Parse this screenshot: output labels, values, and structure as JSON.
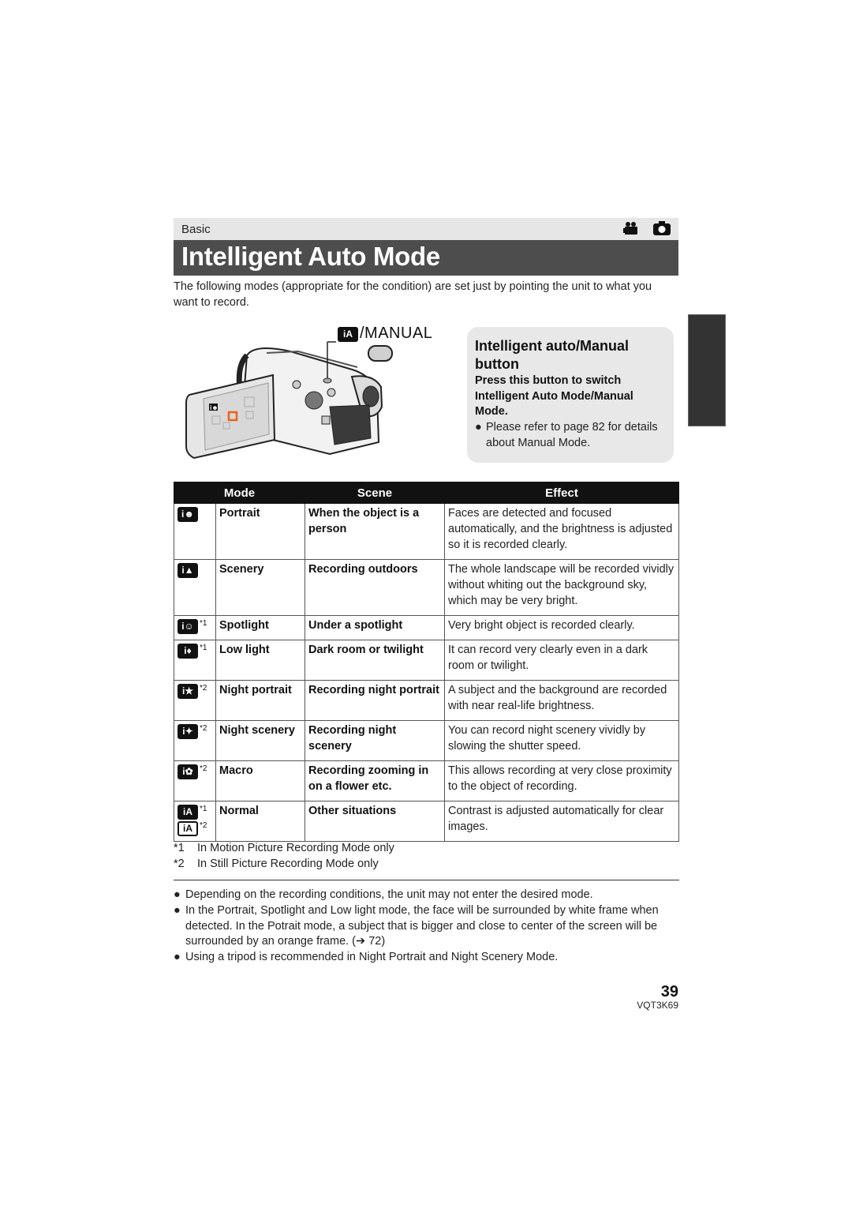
{
  "header": {
    "section": "Basic",
    "mode_icons": [
      "motion-picture-icon",
      "still-picture-icon"
    ],
    "title": "Intelligent Auto Mode"
  },
  "intro": "The following modes (appropriate for the condition) are set just by pointing the unit to what you want to record.",
  "illustration": {
    "button_label_icon": "iA",
    "button_label": "/MANUAL",
    "screen_icon": "i-portrait"
  },
  "callout": {
    "title": "Intelligent auto/Manual button",
    "instruction": "Press this button to switch Intelligent Auto Mode/Manual Mode.",
    "note": "Please refer to page 82 for details about Manual Mode."
  },
  "table": {
    "headers": [
      "Mode",
      "Scene",
      "Effect"
    ],
    "rows": [
      {
        "icons": [
          {
            "glyph": "i☻",
            "footnote": ""
          }
        ],
        "mode": "Portrait",
        "scene": "When the object is a person",
        "effect": "Faces are detected and focused automatically, and the brightness is adjusted so it is recorded clearly."
      },
      {
        "icons": [
          {
            "glyph": "i▲",
            "footnote": ""
          }
        ],
        "mode": "Scenery",
        "scene": "Recording outdoors",
        "effect": "The whole landscape will be recorded vividly without whiting out the background sky, which may be very bright."
      },
      {
        "icons": [
          {
            "glyph": "i☺",
            "footnote": "*1"
          }
        ],
        "mode": "Spotlight",
        "scene": "Under a spotlight",
        "effect": "Very bright object is recorded clearly."
      },
      {
        "icons": [
          {
            "glyph": "i♦",
            "footnote": "*1"
          }
        ],
        "mode": "Low light",
        "scene": "Dark room or twilight",
        "effect": "It can record very clearly even in a dark room or twilight."
      },
      {
        "icons": [
          {
            "glyph": "i★",
            "footnote": "*2"
          }
        ],
        "mode": "Night portrait",
        "scene": "Recording night portrait",
        "effect": "A subject and the background are recorded with near real-life brightness."
      },
      {
        "icons": [
          {
            "glyph": "i✦",
            "footnote": "*2"
          }
        ],
        "mode": "Night scenery",
        "scene": "Recording night scenery",
        "effect": "You can record night scenery vividly by slowing the shutter speed."
      },
      {
        "icons": [
          {
            "glyph": "i✿",
            "footnote": "*2"
          }
        ],
        "mode": "Macro",
        "scene": "Recording zooming in on a flower etc.",
        "effect": "This allows recording at very close proximity to the object of recording."
      },
      {
        "icons": [
          {
            "glyph": "iA",
            "footnote": "*1"
          },
          {
            "glyph": "iA",
            "footnote": "*2"
          }
        ],
        "mode": "Normal",
        "scene": "Other situations",
        "effect": "Contrast is adjusted automatically for clear images."
      }
    ]
  },
  "footnotes": [
    {
      "mark": "*1",
      "text": "In Motion Picture Recording Mode only"
    },
    {
      "mark": "*2",
      "text": "In Still Picture Recording Mode only"
    }
  ],
  "notes": [
    "Depending on the recording conditions, the unit may not enter the desired mode.",
    "In the Portrait, Spotlight and Low light mode, the face will be surrounded by white frame when detected. In the Potrait mode, a subject that is bigger and close to center of the screen will be surrounded by an orange frame. (➔ 72)",
    "Using a tripod is recommended in Night Portrait and Night Scenery Mode."
  ],
  "footer": {
    "page_number": "39",
    "doc_code": "VQT3K69"
  },
  "colors": {
    "title_bar": "#4d4d4d",
    "section_bar": "#e6e6e6",
    "callout_bg": "#e8e8e8",
    "side_tab": "#333333",
    "orange_frame": "#e8641e"
  }
}
